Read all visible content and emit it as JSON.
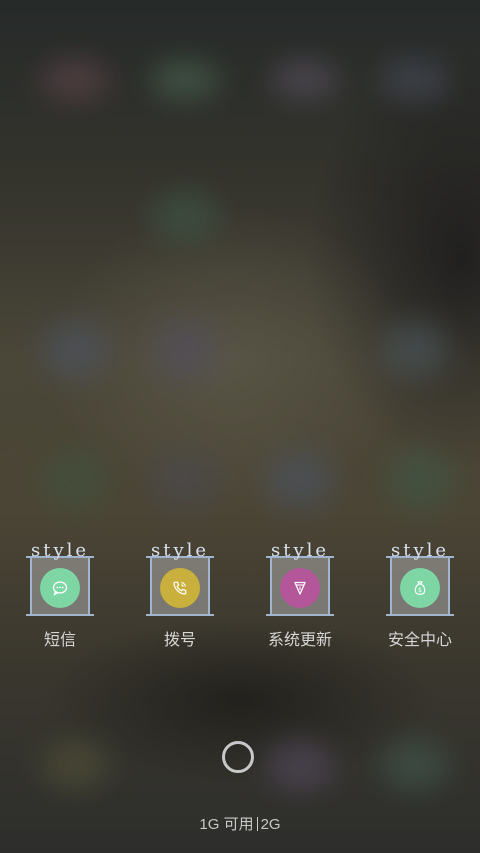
{
  "dock": {
    "apps": [
      {
        "name": "短信",
        "badge_text": "style",
        "icon": "message-icon",
        "color": "#7dd6a3"
      },
      {
        "name": "拨号",
        "badge_text": "style",
        "icon": "phone-icon",
        "color": "#c9b03c"
      },
      {
        "name": "系统更新",
        "badge_text": "style",
        "icon": "pen-icon",
        "color": "#b4579a"
      },
      {
        "name": "安全中心",
        "badge_text": "style",
        "icon": "moneybag-icon",
        "color": "#7dd6a3"
      }
    ]
  },
  "status": {
    "memory_free": "1G 可用",
    "memory_total": "2G"
  }
}
